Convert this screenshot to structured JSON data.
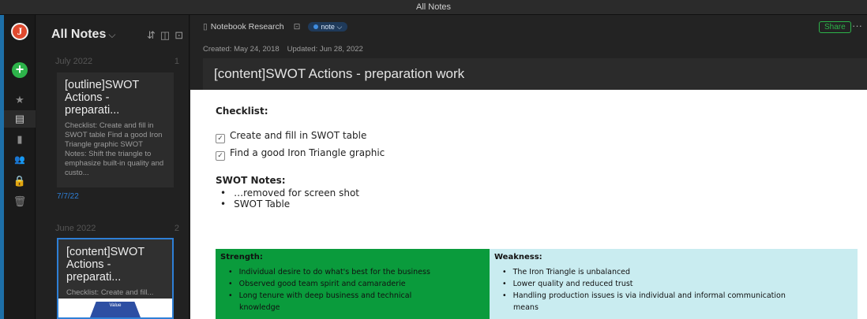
{
  "window": {
    "title": "All Notes"
  },
  "sidebar": {
    "avatar_letter": "J",
    "new_note_symbol": "+",
    "items": [
      "star-icon",
      "notes-icon",
      "notebook-icon",
      "shared-icon",
      "lock-icon",
      "trash-icon"
    ]
  },
  "notelist": {
    "title": "All Notes",
    "sections": [
      {
        "label": "July 2022",
        "count": "1",
        "cards": [
          {
            "title": "[outline]SWOT Actions - preparati...",
            "snippet": "Checklist: Create and fill in SWOT table Find a good Iron Triangle graphic SWOT Notes: Shift the triangle to emphasize built-in quality and custo..."
          }
        ],
        "date_link": "7/7/22"
      },
      {
        "label": "June 2022",
        "count": "2",
        "cards": [
          {
            "title": "[content]SWOT Actions - preparati...",
            "snippet": "Checklist: Create and fill...",
            "thumb_text": "Value"
          }
        ]
      }
    ]
  },
  "note": {
    "notebook": "Notebook Research",
    "tag": "note",
    "share_label": "Share",
    "more_label": "···",
    "created": "Created: May 24, 2018",
    "updated": "Updated: Jun 28, 2022",
    "title": "[content]SWOT Actions - preparation work",
    "checklist_heading": "Checklist:",
    "checklist": [
      {
        "text": "Create and fill in SWOT table",
        "checked": true
      },
      {
        "text": "Find a good Iron Triangle graphic",
        "checked": true
      }
    ],
    "swot_notes_heading": "SWOT Notes:",
    "swot_notes": [
      "…removed for screen shot",
      "SWOT Table"
    ],
    "strength": {
      "heading": "Strength:",
      "items": [
        "Individual desire to do what's best for the business",
        "Observed good team spirit and camaraderie",
        "Long tenure with deep business and technical",
        "knowledge"
      ]
    },
    "weakness": {
      "heading": "Weakness:",
      "items": [
        "The Iron Triangle is unbalanced",
        "Lower quality and reduced trust",
        "Handling production issues is via individual and informal communication",
        "means"
      ]
    }
  }
}
